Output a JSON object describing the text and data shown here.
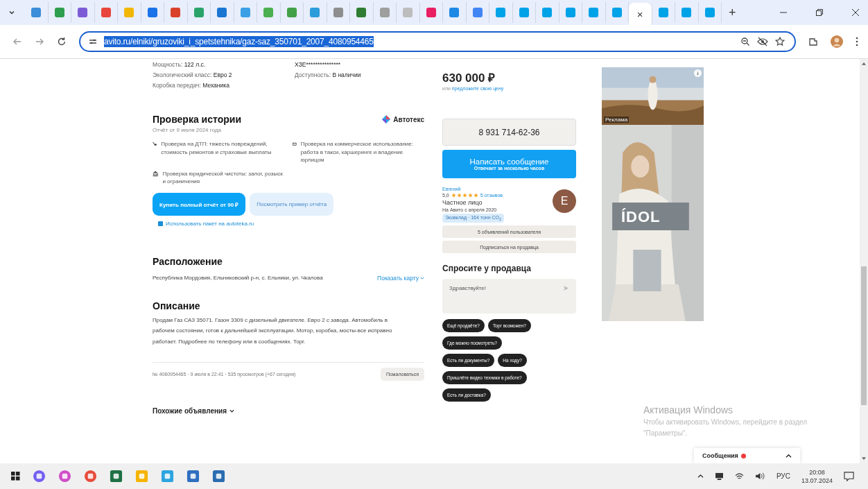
{
  "browser": {
    "tabs": [
      {
        "selected": false
      },
      {
        "selected": false
      },
      {
        "selected": false
      },
      {
        "selected": false
      },
      {
        "selected": false
      },
      {
        "selected": false
      },
      {
        "selected": false
      },
      {
        "selected": false
      },
      {
        "selected": false
      },
      {
        "selected": false
      },
      {
        "selected": false
      },
      {
        "selected": false
      },
      {
        "selected": false
      },
      {
        "selected": false
      },
      {
        "selected": false
      },
      {
        "selected": false
      },
      {
        "selected": false
      },
      {
        "selected": false
      },
      {
        "selected": false
      },
      {
        "selected": false
      },
      {
        "selected": false
      },
      {
        "selected": false
      },
      {
        "selected": false
      },
      {
        "selected": false
      },
      {
        "selected": false
      },
      {
        "selected": false
      },
      {
        "selected": true,
        "close": "×"
      },
      {
        "selected": false
      },
      {
        "selected": false
      },
      {
        "selected": false
      }
    ],
    "new_tab": "+",
    "url": "avito.ru/elniki/gruzoviki_i_spetstehnika/gaz-saz_350701_2007_4080954465"
  },
  "specs": {
    "left": [
      {
        "label": "Мощность:",
        "value": "122 л.с."
      },
      {
        "label": "Экологический класс:",
        "value": "Евро 2"
      },
      {
        "label": "Коробка передач:",
        "value": "Механика"
      }
    ],
    "right": [
      {
        "value": "XЗЕ***************"
      },
      {
        "label": "Доступность:",
        "value": "В наличии"
      }
    ]
  },
  "history": {
    "title": "Проверка истории",
    "brand": "Автотекс",
    "subtitle": "Отчёт от 9 июля 2024 года",
    "checks": [
      {
        "kind": "accident",
        "text": "Проверка на ДТП: тяжесть повреждений, стоимость ремонтов и страховые выплаты"
      },
      {
        "kind": "commercial",
        "text": "Проверка на коммерческое использование: работа в такси, каршеринге и владение юрлицом"
      },
      {
        "kind": "legal",
        "text": "Проверка юридической чистоты: залог, розыск и ограничения"
      }
    ],
    "buy_button": "Купить полный отчёт от 90 ₽",
    "sample_button": "Посмотреть пример отчёта",
    "package_link": "Использовать пакет на autoteka.ru"
  },
  "location": {
    "title": "Расположение",
    "address": "Республика Мордовия, Ельниковский р-н, с. Ельники, ул. Чкалова",
    "map_link": "Показать карту"
  },
  "description": {
    "title": "Описание",
    "text": "Продам Газ САЗ 35071. Газон 3309 с дизельный двигателе. Евро 2 с завода. Автомобиль в рабочем состоянии, готов к дальнейшей эксплуатации. Мотор, коробка, мосты-все исправно работает. Подробнее по телефону или в сообщениях. Торг."
  },
  "meta": {
    "text": "№ 4080954465 · 9 июля в 22:41 · 535 просмотров (+67 сегодня)",
    "report_button": "Пожаловаться"
  },
  "similar": {
    "title": "Похожие объявления"
  },
  "price": {
    "amount": "630 000 ₽",
    "prefix": "или",
    "offer_link": "предложите свою цену"
  },
  "phone_button": "8 931 714-62-36",
  "message_button": {
    "title": "Написать сообщение",
    "subtitle": "Отвечает за несколько часов"
  },
  "seller": {
    "name": "Евгений",
    "rating": "5,0",
    "stars": 5,
    "reviews": "5 отзывов",
    "type": "Частное лицо",
    "since": "На Авито с апреля 2020",
    "eco": "Эковклад · 164 тонн CO$_{2}$",
    "avatar": "E",
    "ads_button": "5 объявлений пользователя",
    "subscribe_button": "Подписаться на продавца"
  },
  "ask": {
    "title": "Спросите у продавца",
    "value": "Здравствуйте!",
    "chips": [
      [
        "Ещё продаёте?",
        "Торг возможен?"
      ],
      [
        "Где можно посмотреть?"
      ],
      [
        "Есть ли документы?",
        "На ходу?"
      ],
      [
        "Пришлёте видео техники в работе?"
      ],
      [
        "Есть ли доставка?"
      ]
    ]
  },
  "ad": {
    "label": "Реклама",
    "brand": "ÍDOL"
  },
  "activation": {
    "title": "Активация Windows",
    "text": "Чтобы активировать Windows, перейдите в раздел \"Параметры\"."
  },
  "messages_popup": {
    "label": "Сообщения"
  },
  "taskbar": {
    "language": "РУС",
    "time": "20:08",
    "date": "13.07.2024"
  }
}
